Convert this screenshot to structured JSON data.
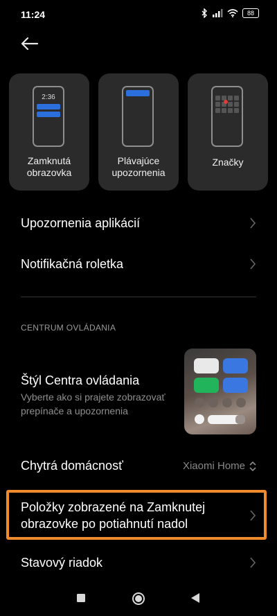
{
  "status_bar": {
    "time": "11:24",
    "battery": "88"
  },
  "tiles": [
    {
      "label": "Zamknutá obrazovka",
      "lines": [
        "Zamknutá",
        "obrazovka"
      ],
      "preview_time": "2:36"
    },
    {
      "label": "Plávajúce upozornenia",
      "lines": [
        "Plávajúce",
        "upozornenia"
      ]
    },
    {
      "label": "Značky",
      "lines": [
        "Značky"
      ]
    }
  ],
  "list": {
    "app_notifications": "Upozornenia aplikácií",
    "notification_shade": "Notifikačná roletka"
  },
  "control_center": {
    "section_title": "CENTRUM OVLÁDANIA",
    "style_title": "Štýl Centra ovládania",
    "style_subtitle": "Vyberte ako si prajete zobrazovať prepínače a upozornenia",
    "smart_home_title": "Chytrá domácnosť",
    "smart_home_value": "Xiaomi Home",
    "lockscreen_items_title": "Položky zobrazené na Zamknutej obrazovke po potiahnutí nadol",
    "status_bar_title": "Stavový riadok"
  },
  "colors": {
    "background": "#000000",
    "tile": "#2b2b2b",
    "accent_blue": "#2a6fdc",
    "highlight": "#f08b2d"
  }
}
